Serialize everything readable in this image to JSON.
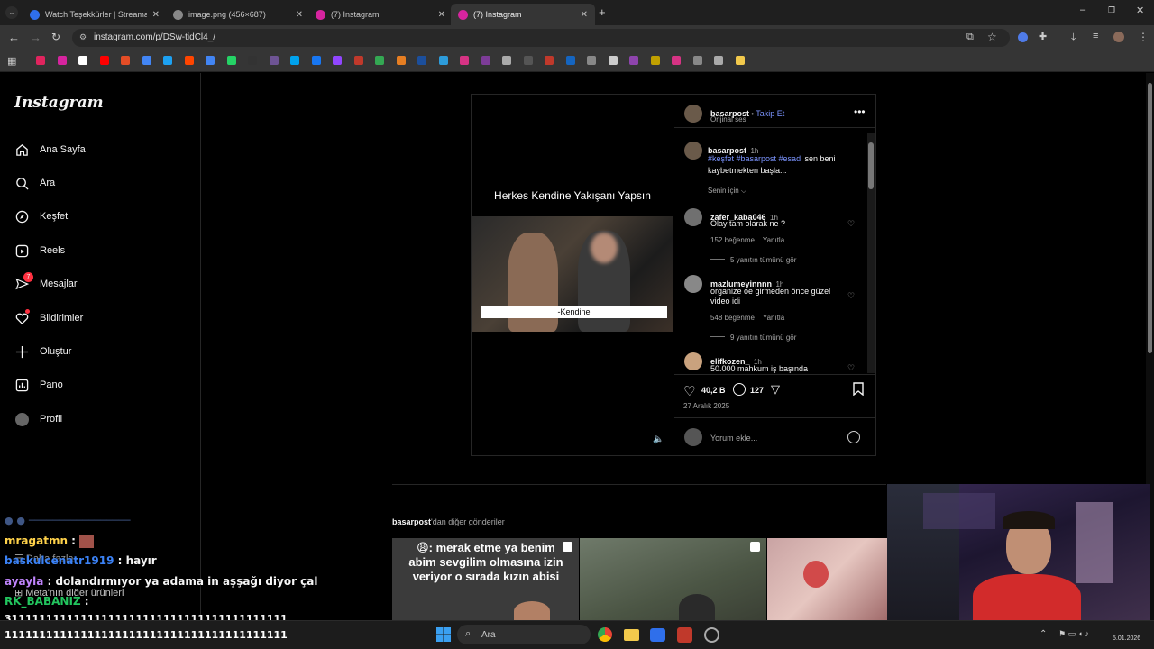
{
  "browser": {
    "tabs": [
      {
        "title": "Watch Teşekkürler | Streamable",
        "color": "#2f6feb"
      },
      {
        "title": "image.png (456×687)",
        "color": "#888888"
      },
      {
        "title": "(7) Instagram",
        "color": "#d6249f"
      },
      {
        "title": "(7) Instagram",
        "color": "#d6249f"
      }
    ],
    "url": "instagram.com/p/DSw-tidCl4_/"
  },
  "nav": {
    "logo": "Instagram",
    "items": [
      "Ana Sayfa",
      "Ara",
      "Keşfet",
      "Reels",
      "Mesajlar",
      "Bildirimler",
      "Oluştur",
      "Pano",
      "Profil"
    ],
    "messages_badge": "7",
    "more_label": "Daha fazla",
    "meta_label": "Meta'nın diğer ürünleri"
  },
  "post": {
    "video_title": "Herkes Kendine Yakışanı Yapsın",
    "video_caption": "-Kendine",
    "author": "basarpost",
    "follow": "Takip Et",
    "audio": "Orijinal ses",
    "caption_time": "1h",
    "caption_tags": "#keşfet #basarpost #esad",
    "caption_text": "sen beni kaybetmekten başla...",
    "sort": "Senin için",
    "comments": [
      {
        "user": "zafer_kaba046",
        "time": "1h",
        "text": "Olay tam olarak ne ?",
        "likes": "152 beğenme",
        "reply": "Yanıtla",
        "view": "5 yanıtın tümünü gör"
      },
      {
        "user": "mazlumeyinnnn",
        "time": "1h",
        "text": "organize oe girmeden önce güzel video idi",
        "likes": "548 beğenme",
        "reply": "Yanıtla",
        "view": "9 yanıtın tümünü gör"
      },
      {
        "user": "elifkozen_",
        "time": "1h",
        "text": "50.000 mahkum iş başında"
      }
    ],
    "likes": "40,2 B",
    "comment_count": "127",
    "date": "27 Aralık 2025",
    "add_comment": "Yorum ekle..."
  },
  "more_posts": {
    "label_user": "basarpost",
    "label_rest": "'dan diğer gönderiler",
    "tile1_text": "😩: merak etme ya benim abim sevgilim olmasına izin veriyor o sırada kızın abisi"
  },
  "chat": [
    {
      "user": "mragatmn",
      "sep": " : ",
      "msg": "",
      "color": "#ffd24a"
    },
    {
      "user": "baskulcenatr1919",
      "sep": " : ",
      "msg": "hayır",
      "color": "#3b82f6"
    },
    {
      "user": "ayayla",
      "sep": " : ",
      "msg": "dolandırmıyor ya adama in aşşağı diyor çal",
      "color": "#c084fc"
    },
    {
      "user": "RK_BABANIZ",
      "sep": " : ",
      "msg": "",
      "color": "#22c55e"
    },
    {
      "user": "",
      "sep": "",
      "msg": "31111111111111111111111111111111111111111",
      "color": "#ffffff"
    },
    {
      "user": "",
      "sep": "",
      "msg": "11111111111111111111111111111111111111111",
      "color": "#ffffff"
    }
  ],
  "taskbar": {
    "search": "Ara",
    "date": "5.01.2026"
  }
}
